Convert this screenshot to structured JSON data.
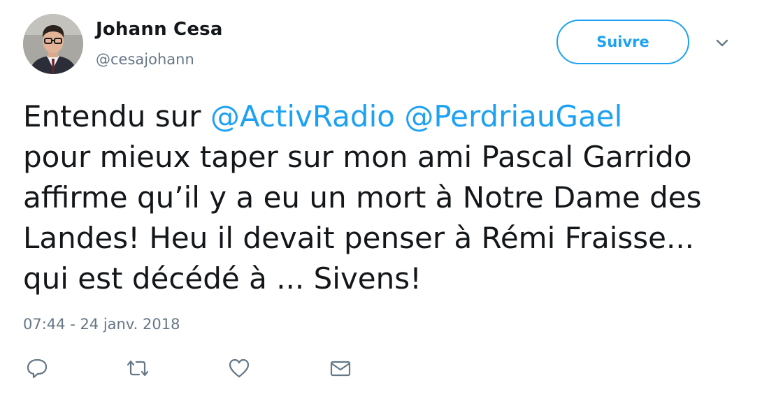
{
  "author": {
    "name": "Johann Cesa",
    "handle": "@cesajohann"
  },
  "follow_button": {
    "label": "Suivre"
  },
  "tweet": {
    "lines": [
      {
        "text": "Entendu sur ",
        "mention1": "@ActivRadio",
        "mention2": "@PerdriauGael"
      },
      {
        "text": "pour mieux taper sur mon ami Pascal Garrido"
      },
      {
        "text": "affirme qu’il y a eu un mort à Notre Dame des"
      },
      {
        "text": "Landes! Heu il devait penser à Rémi Fraisse..."
      },
      {
        "text": "qui est décédé à ... Sivens!"
      }
    ],
    "timestamp": "07:44 - 24 janv. 2018"
  },
  "icons": {
    "more": "chevron-down-icon",
    "reply": "reply-icon",
    "retweet": "retweet-icon",
    "like": "heart-icon",
    "dm": "envelope-icon"
  },
  "colors": {
    "accent": "#1da1f2",
    "text": "#14171a",
    "secondary": "#657786"
  }
}
